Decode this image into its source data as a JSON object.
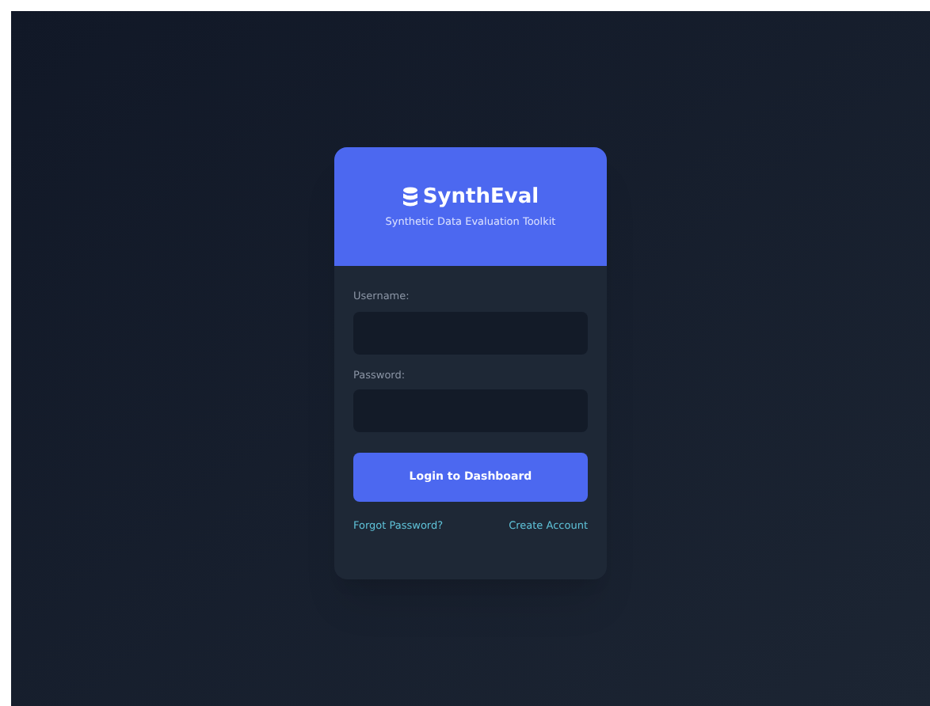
{
  "brand": {
    "name": "SynthEval",
    "tagline": "Synthetic Data Evaluation Toolkit"
  },
  "fields": [
    {
      "label": "Username:"
    },
    {
      "label": "Password:"
    }
  ],
  "submit": "Login to Dashboard",
  "links": [
    "Forgot Password?",
    "Create Account"
  ]
}
